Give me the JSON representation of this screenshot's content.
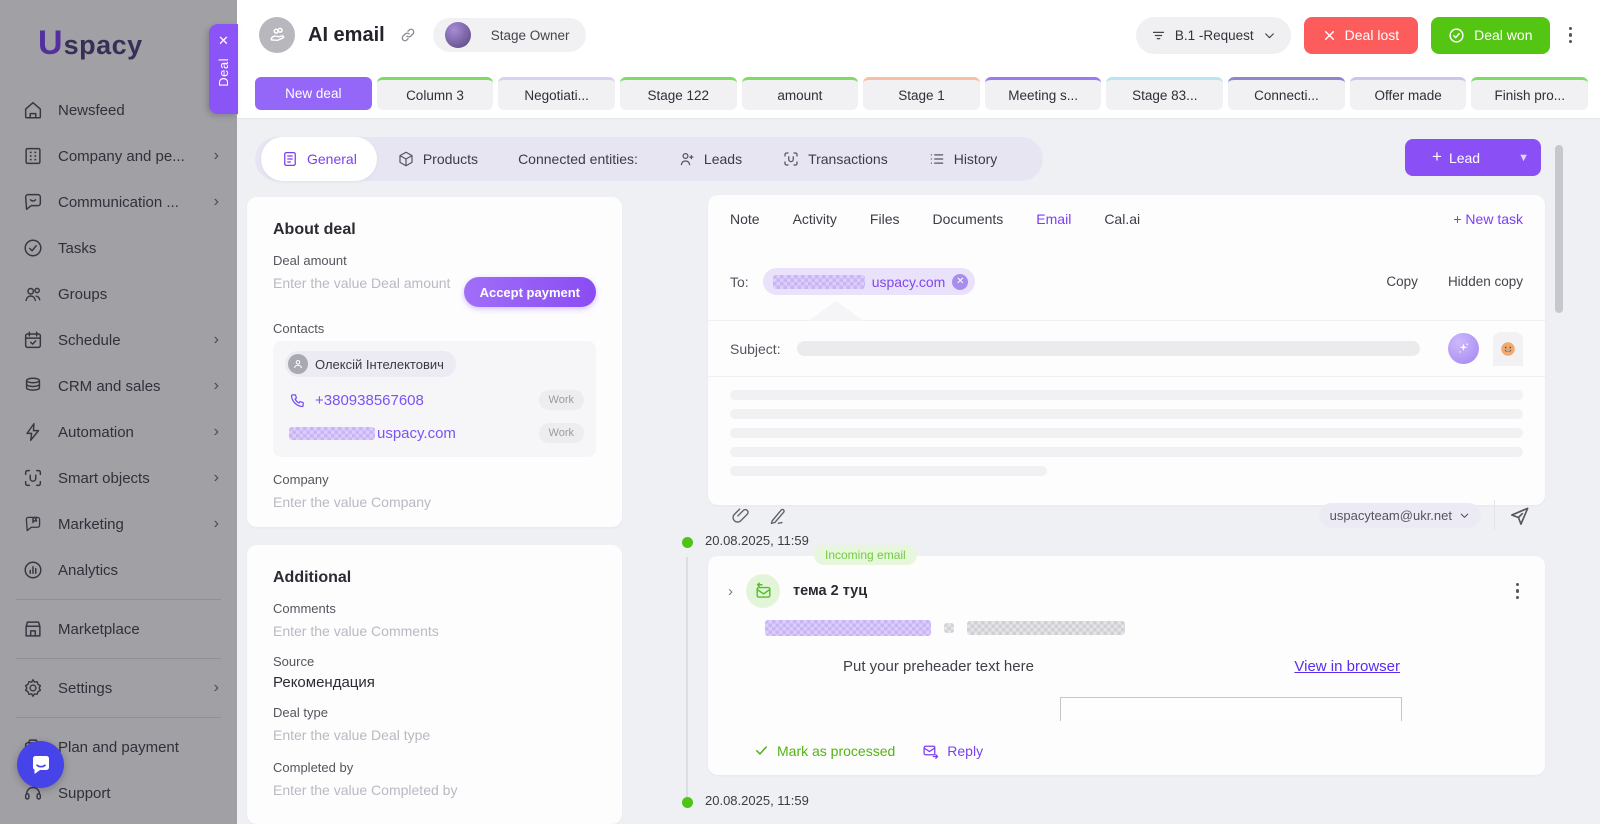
{
  "colors": {
    "accent": "#8a4ff5",
    "danger": "#fc5c5c",
    "success": "#54c513",
    "link": "#7b52f5"
  },
  "brand": {
    "logo_u": "U",
    "logo_text": "spacy"
  },
  "sidebar": {
    "items": [
      {
        "label": "Newsfeed"
      },
      {
        "label": "Company and pe..."
      },
      {
        "label": "Communication ..."
      },
      {
        "label": "Tasks"
      },
      {
        "label": "Groups"
      },
      {
        "label": "Schedule"
      },
      {
        "label": "CRM and sales"
      },
      {
        "label": "Automation"
      },
      {
        "label": "Smart objects"
      },
      {
        "label": "Marketing"
      },
      {
        "label": "Analytics"
      },
      {
        "label": "Marketplace"
      },
      {
        "label": "Settings"
      },
      {
        "label": "Plan and payment"
      },
      {
        "label": "Support"
      }
    ]
  },
  "deal_tab": {
    "label": "Deal"
  },
  "header": {
    "title": "AI email",
    "owner": "Stage Owner",
    "pipeline": "B.1 -Request",
    "deal_lost": "Deal lost",
    "deal_won": "Deal won"
  },
  "stages": [
    {
      "label": "New deal",
      "color": "#9467f8",
      "active": true
    },
    {
      "label": "Column 3",
      "color": "#7edc63"
    },
    {
      "label": "Negotiati...",
      "color": "#d9d0f3"
    },
    {
      "label": "Stage 122",
      "color": "#7edc63"
    },
    {
      "label": "amount",
      "color": "#7edc63"
    },
    {
      "label": "Stage 1",
      "color": "#f6bfa4"
    },
    {
      "label": "Meeting s...",
      "color": "#9b7bf2"
    },
    {
      "label": "Stage 83...",
      "color": "#b5e6f2"
    },
    {
      "label": "Connecti...",
      "color": "#9185cf"
    },
    {
      "label": "Offer made",
      "color": "#cfc2ef"
    },
    {
      "label": "Finish pro...",
      "color": "#7edc63"
    }
  ],
  "deal_tabs": {
    "general": "General",
    "products": "Products",
    "connected": "Connected entities:",
    "leads": "Leads",
    "transactions": "Transactions",
    "history": "History",
    "lead_button": "Lead"
  },
  "about": {
    "title": "About deal",
    "deal_amount_label": "Deal amount",
    "deal_amount_placeholder": "Enter the value Deal amount",
    "accept_payment": "Accept payment",
    "contacts_label": "Contacts",
    "contact_name": "Олексій Інтелектович",
    "phone": "+380938567608",
    "phone_tag": "Work",
    "email_visible": "uspacy.com",
    "email_tag": "Work",
    "company_label": "Company",
    "company_placeholder": "Enter the value Company"
  },
  "additional": {
    "title": "Additional",
    "comments_label": "Comments",
    "comments_placeholder": "Enter the value Comments",
    "source_label": "Source",
    "source_value": "Рекомендация",
    "deal_type_label": "Deal type",
    "deal_type_placeholder": "Enter the value Deal type",
    "completed_label": "Completed by",
    "completed_placeholder": "Enter the value Completed by"
  },
  "composer": {
    "tab_note": "Note",
    "tab_activity": "Activity",
    "tab_files": "Files",
    "tab_documents": "Documents",
    "tab_email": "Email",
    "tab_calai": "Cal.ai",
    "new_task": "New task",
    "to_label": "To:",
    "recipient_domain": "uspacy.com",
    "copy": "Copy",
    "hidden_copy": "Hidden copy",
    "subject_label": "Subject:",
    "from_account": "uspacyteam@ukr.net"
  },
  "timeline": {
    "date1": "20.08.2025, 11:59",
    "badge": "Incoming email",
    "email_title": "тема 2 туц",
    "preheader": "Put your preheader text here",
    "view_in_browser": "View in browser",
    "mark_processed": "Mark as processed",
    "reply": "Reply",
    "date2": "20.08.2025, 11:59"
  }
}
